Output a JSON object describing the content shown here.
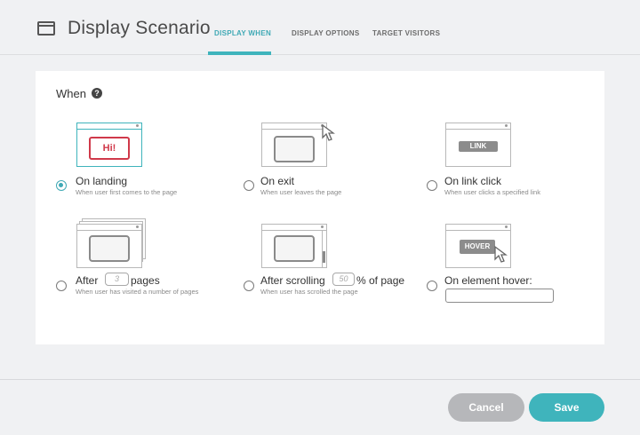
{
  "header": {
    "title": "Display Scenario",
    "tabs": [
      {
        "label": "DISPLAY WHEN",
        "active": true
      },
      {
        "label": "DISPLAY OPTIONS",
        "active": false
      },
      {
        "label": "TARGET VISITORS",
        "active": false
      }
    ]
  },
  "panel": {
    "when_label": "When",
    "help_icon": "?",
    "options": [
      {
        "label": "On landing",
        "sub": "When user first comes to the page",
        "selected": true,
        "illustration_text": "Hi!"
      },
      {
        "label": "On exit",
        "sub": "When user leaves the page",
        "selected": false
      },
      {
        "label": "On link click",
        "sub": "When user clicks a specified link",
        "selected": false,
        "illustration_text": "LINK"
      },
      {
        "label_before": "After",
        "input_placeholder": "3",
        "label_after": "pages",
        "sub": "When user has visited a number of pages",
        "selected": false
      },
      {
        "label_before": "After scrolling",
        "input_placeholder": "50",
        "label_after": "% of page",
        "sub": "When user has scrolled the page",
        "selected": false
      },
      {
        "label": "On element hover:",
        "selected": false,
        "illustration_text": "HOVER",
        "input_value": ""
      }
    ]
  },
  "footer": {
    "cancel_label": "Cancel",
    "save_label": "Save"
  },
  "colors": {
    "accent": "#3fb4bc",
    "highlight_red": "#d0394a",
    "cancel_gray": "#b6b7ba"
  }
}
